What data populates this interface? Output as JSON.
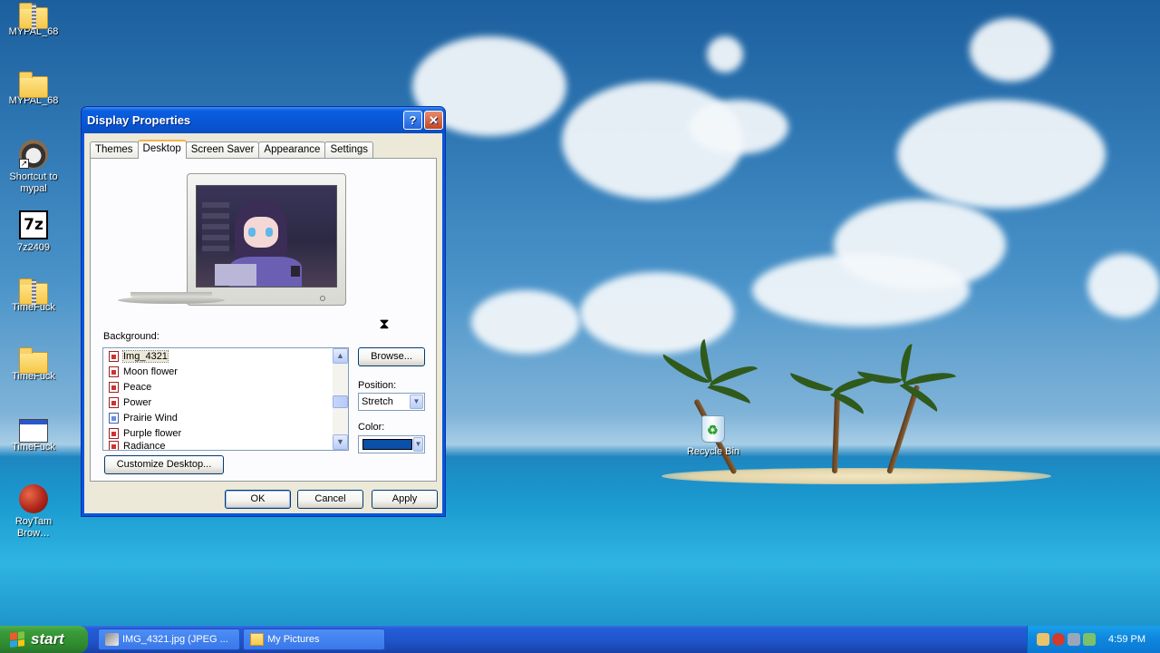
{
  "desktop_icons": [
    {
      "label": "MYPAL_68",
      "icon": "zip-folder-icon"
    },
    {
      "label": "MYPAL_68",
      "icon": "folder-icon"
    },
    {
      "label": "Shortcut to mypal",
      "icon": "mypal-raccoon-icon"
    },
    {
      "label": "7z2409",
      "icon": "7zip-icon"
    },
    {
      "label": "TimeFuck",
      "icon": "zip-folder-icon"
    },
    {
      "label": "TimeFuck",
      "icon": "folder-icon"
    },
    {
      "label": "TimeFuck",
      "icon": "application-window-icon"
    },
    {
      "label": "RoyTam Brow…",
      "icon": "roytam-browser-icon"
    }
  ],
  "recycle_bin": {
    "label": "Recycle Bin"
  },
  "dialog": {
    "title": "Display Properties",
    "help_glyph": "?",
    "close_glyph": "✕",
    "tabs": [
      "Themes",
      "Desktop",
      "Screen Saver",
      "Appearance",
      "Settings"
    ],
    "active_tab": "Desktop",
    "background_label": "Background:",
    "background_items": [
      {
        "name": "Img_4321",
        "selected": true
      },
      {
        "name": "Moon flower"
      },
      {
        "name": "Peace"
      },
      {
        "name": "Power"
      },
      {
        "name": "Prairie Wind"
      },
      {
        "name": "Purple flower"
      },
      {
        "name": "Radiance"
      }
    ],
    "browse_label": "Browse...",
    "position_label": "Position:",
    "position_value": "Stretch",
    "color_label": "Color:",
    "color_value": "#0a4fa8",
    "customize_label": "Customize Desktop...",
    "ok_label": "OK",
    "cancel_label": "Cancel",
    "apply_label": "Apply"
  },
  "taskbar": {
    "start_label": "start",
    "items": [
      {
        "label": "IMG_4321.jpg (JPEG ...",
        "icon": "image-viewer-icon"
      },
      {
        "label": "My Pictures",
        "icon": "folder-icon"
      }
    ],
    "clock": "4:59 PM"
  },
  "colors": {
    "start_green": "#3a9c3a",
    "taskbar_blue": "#245edb",
    "title_blue": "#0756d6",
    "tab_highlight": "#f7b24a"
  }
}
